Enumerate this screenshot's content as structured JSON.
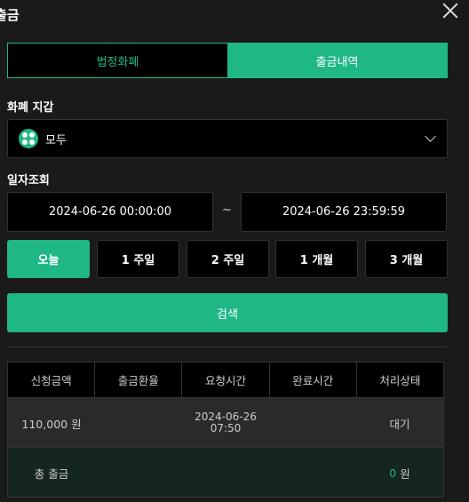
{
  "header": {
    "title": "출금"
  },
  "tabs": [
    {
      "label": "법정화폐",
      "active": false
    },
    {
      "label": "출금내역",
      "active": true
    }
  ],
  "wallet": {
    "label": "화폐 지갑",
    "selected": "모두"
  },
  "date_query": {
    "label": "일자조회",
    "start": "2024-06-26 00:00:00",
    "separator": "~",
    "end": "2024-06-26 23:59:59"
  },
  "ranges": [
    {
      "label": "오늘",
      "active": true
    },
    {
      "label": "1 주일",
      "active": false
    },
    {
      "label": "2 주일",
      "active": false
    },
    {
      "label": "1 개월",
      "active": false
    },
    {
      "label": "3 개월",
      "active": false
    }
  ],
  "search_label": "검색",
  "table": {
    "headers": [
      "신청금액",
      "출금환율",
      "요청시간",
      "완료시간",
      "처리상태"
    ],
    "rows": [
      {
        "amount": "110,000 원",
        "rate": "",
        "request_date": "2024-06-26",
        "request_time": "07:50",
        "completed": "",
        "status": "대기"
      }
    ],
    "footer": {
      "label": "총 출금",
      "total": "0",
      "unit": "원"
    }
  },
  "colors": {
    "accent": "#20b786",
    "background": "#1a1a1a"
  }
}
